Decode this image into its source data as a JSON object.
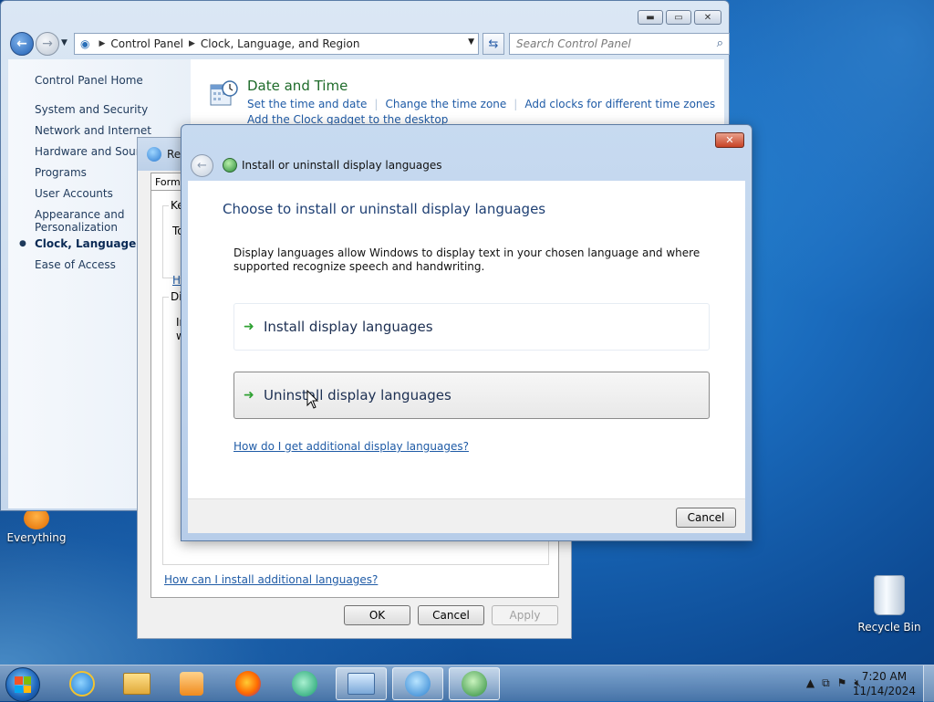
{
  "control_panel": {
    "address": {
      "crumb1": "Control Panel",
      "crumb2": "Clock, Language, and Region"
    },
    "search_placeholder": "Search Control Panel",
    "left_nav": {
      "home": "Control Panel Home",
      "items": [
        "System and Security",
        "Network and Internet",
        "Hardware and Sound",
        "Programs",
        "User Accounts",
        "Appearance and Personalization",
        "Clock, Language, and",
        "Ease of Access"
      ]
    },
    "date_time": {
      "title": "Date and Time",
      "link1": "Set the time and date",
      "link2": "Change the time zone",
      "link3": "Add clocks for different time zones",
      "link4": "Add the Clock gadget to the desktop"
    }
  },
  "region_dialog": {
    "title": "Reg",
    "tab_label": "Forma",
    "group1_title": "Ke",
    "group1_body": "To",
    "group1_link": "H",
    "group2_title": "Di",
    "group2_body_line1": "In",
    "group2_body_line2": "w",
    "help_link": "How can I install additional languages?",
    "ok": "OK",
    "cancel": "Cancel",
    "apply": "Apply"
  },
  "lang_dialog": {
    "title": "Install or uninstall display languages",
    "heading": "Choose to install or uninstall display languages",
    "description": "Display languages allow Windows to display text in your chosen language and where supported recognize speech and handwriting.",
    "install": "Install display languages",
    "uninstall": "Uninstall display languages",
    "help_link": "How do I get additional display languages?",
    "cancel": "Cancel",
    "close_glyph": "✕"
  },
  "desktop": {
    "everything_label": "Everything",
    "recycle_label": "Recycle Bin"
  },
  "taskbar": {
    "time": "7:20 AM",
    "date": "11/14/2024",
    "tray_up": "▲"
  }
}
